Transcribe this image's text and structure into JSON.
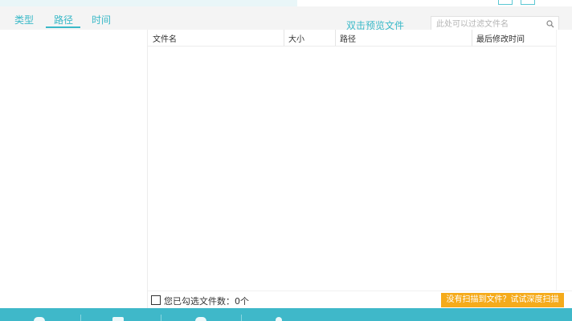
{
  "tabs": [
    {
      "label": "类型"
    },
    {
      "label": "路径"
    },
    {
      "label": "时间"
    }
  ],
  "active_tab": "路径",
  "preview_link": "双击预览文件",
  "search": {
    "placeholder": "此处可以过滤文件名",
    "value": ""
  },
  "table": {
    "columns": [
      {
        "label": "文件名"
      },
      {
        "label": "大小"
      },
      {
        "label": "路径"
      },
      {
        "label": "最后修改时间"
      }
    ],
    "rows": []
  },
  "footer": {
    "selected_label": "您已勾选文件数：0个",
    "checkbox_checked": false,
    "deep_scan_button": "没有扫描到文件？试试深度扫描"
  },
  "colors": {
    "accent": "#3ab9c8",
    "bottom_bar": "#3fb8c9",
    "scan_button": "#f5ab1b"
  }
}
